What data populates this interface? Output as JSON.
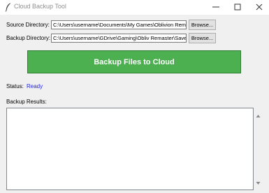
{
  "window": {
    "title": "Cloud Backup Tool",
    "icon": "feather-icon",
    "controls": [
      "minimize-icon",
      "maximize-icon",
      "close-icon"
    ]
  },
  "source": {
    "label": "Source Directory:",
    "value": "C:\\Users\\username\\Documents\\My Games\\Oblivion Remastered",
    "browse_label": "Browse..."
  },
  "backup": {
    "label": "Backup Directory:",
    "value": "C:\\Users\\username\\GDrive\\Gaming\\Obliv Remaster\\Saves",
    "browse_label": "Browse..."
  },
  "action": {
    "label": "Backup Files to Cloud"
  },
  "status": {
    "label": "Status:",
    "value": "Ready"
  },
  "results": {
    "label": "Backup Results:",
    "content": ""
  },
  "colors": {
    "button_bg": "#4caf50",
    "button_text": "#ffffff",
    "status_text": "#2222ee"
  }
}
